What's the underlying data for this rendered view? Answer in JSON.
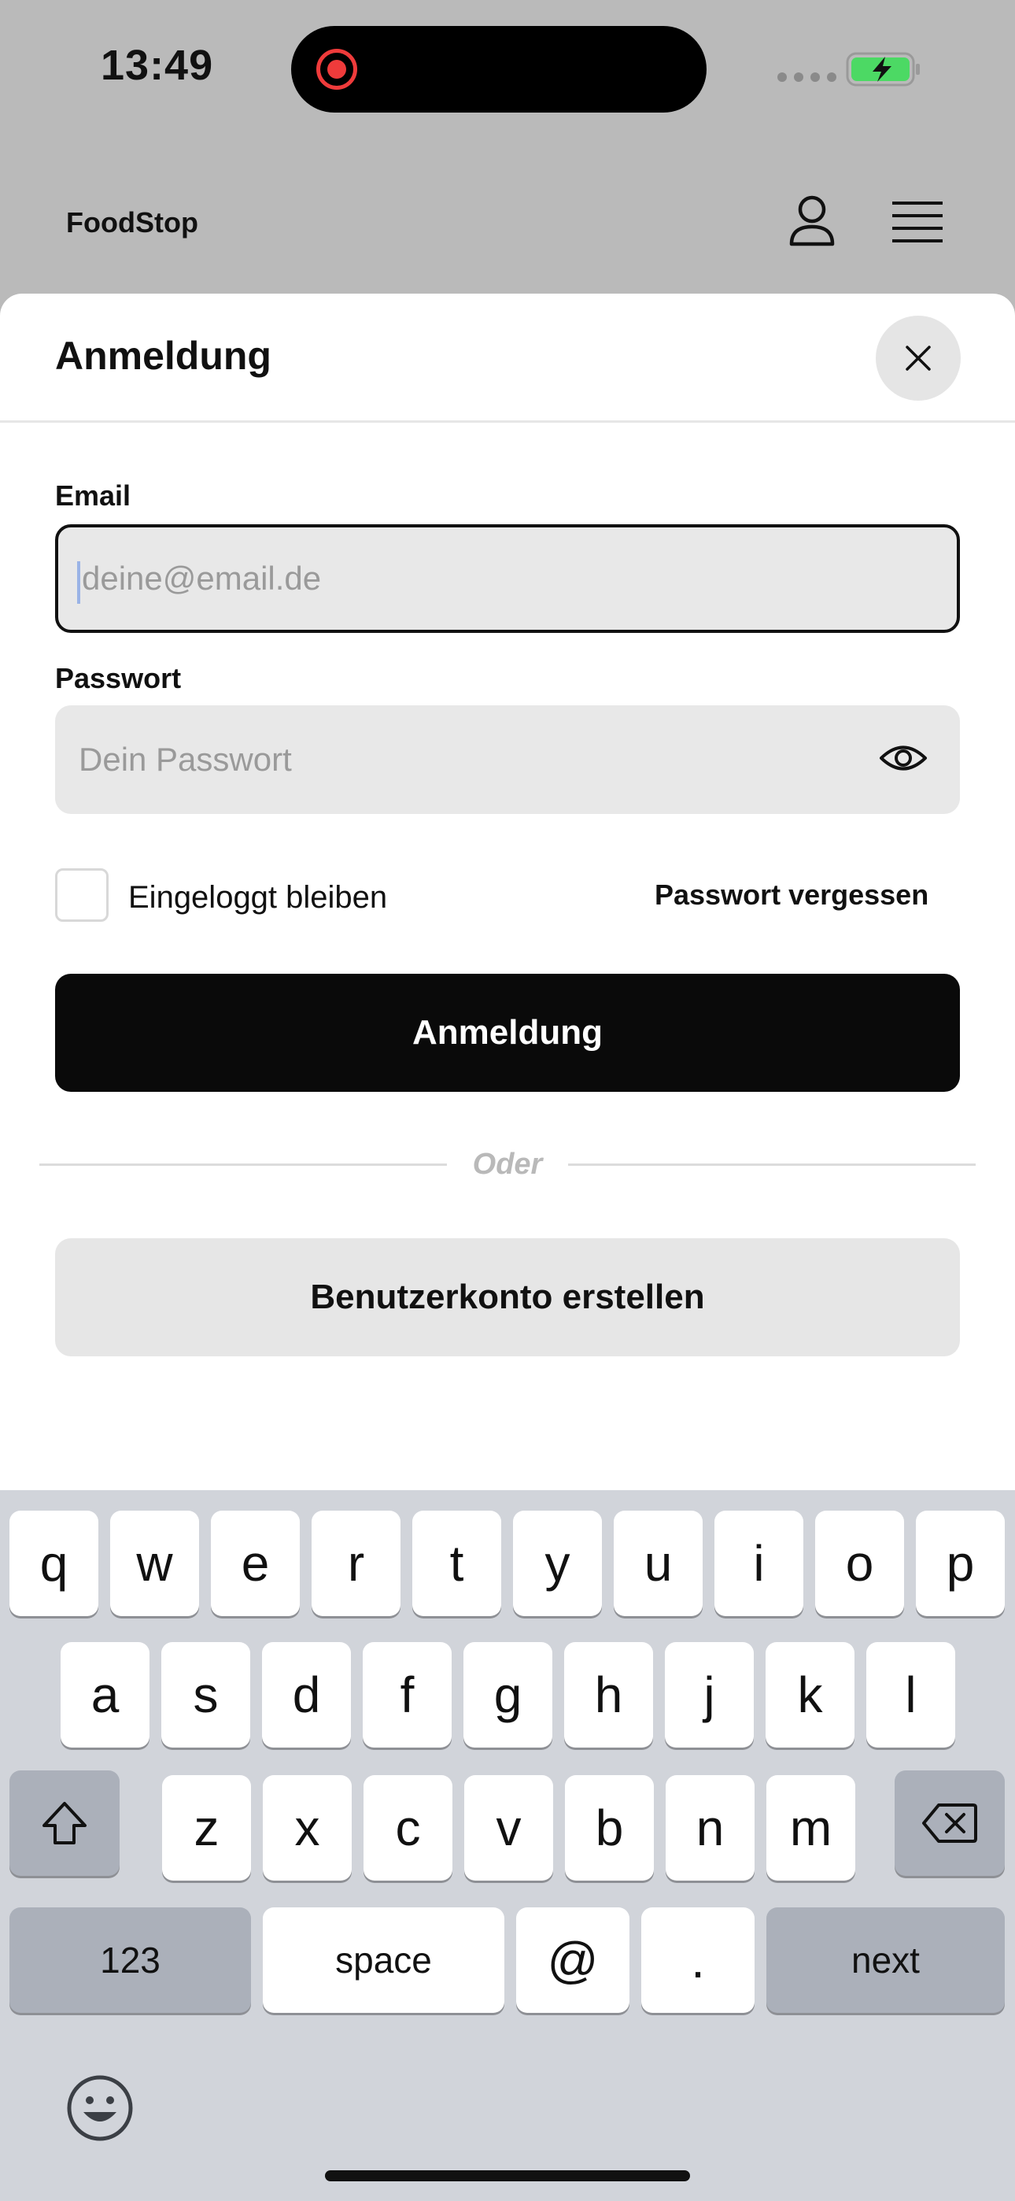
{
  "status_bar": {
    "time": "13:49"
  },
  "header": {
    "brand": "FoodStop",
    "profile_icon": "user-icon",
    "menu_icon": "hamburger-menu-icon"
  },
  "sheet": {
    "title": "Anmeldung",
    "close_icon": "close-icon",
    "email": {
      "label": "Email",
      "placeholder": "deine@email.de",
      "value": ""
    },
    "password": {
      "label": "Passwort",
      "placeholder": "Dein Passwort",
      "value": "",
      "toggle_icon": "eye-icon"
    },
    "remember_me": {
      "label": "Eingeloggt bleiben",
      "checked": false
    },
    "forgot_password": "Passwort vergessen",
    "login_button": "Anmeldung",
    "divider": "Oder",
    "create_account_button": "Benutzerkonto erstellen"
  },
  "keyboard": {
    "row1": [
      "q",
      "w",
      "e",
      "r",
      "t",
      "y",
      "u",
      "i",
      "o",
      "p"
    ],
    "row2": [
      "a",
      "s",
      "d",
      "f",
      "g",
      "h",
      "j",
      "k",
      "l"
    ],
    "row3": [
      "z",
      "x",
      "c",
      "v",
      "b",
      "n",
      "m"
    ],
    "shift_icon": "shift-icon",
    "delete_icon": "backspace-icon",
    "numbers_key": "123",
    "space_key": "space",
    "at_key": "@",
    "dot_key": ".",
    "next_key": "next",
    "emoji_icon": "emoji-icon"
  },
  "colors": {
    "dimmed_background": "#bababa",
    "primary_button": "#0a0a0a",
    "secondary_button": "#e6e6e6",
    "keyboard_background": "#d1d4da",
    "recording_indicator": "#ef3b3b",
    "battery_charging": "#4cd964"
  }
}
